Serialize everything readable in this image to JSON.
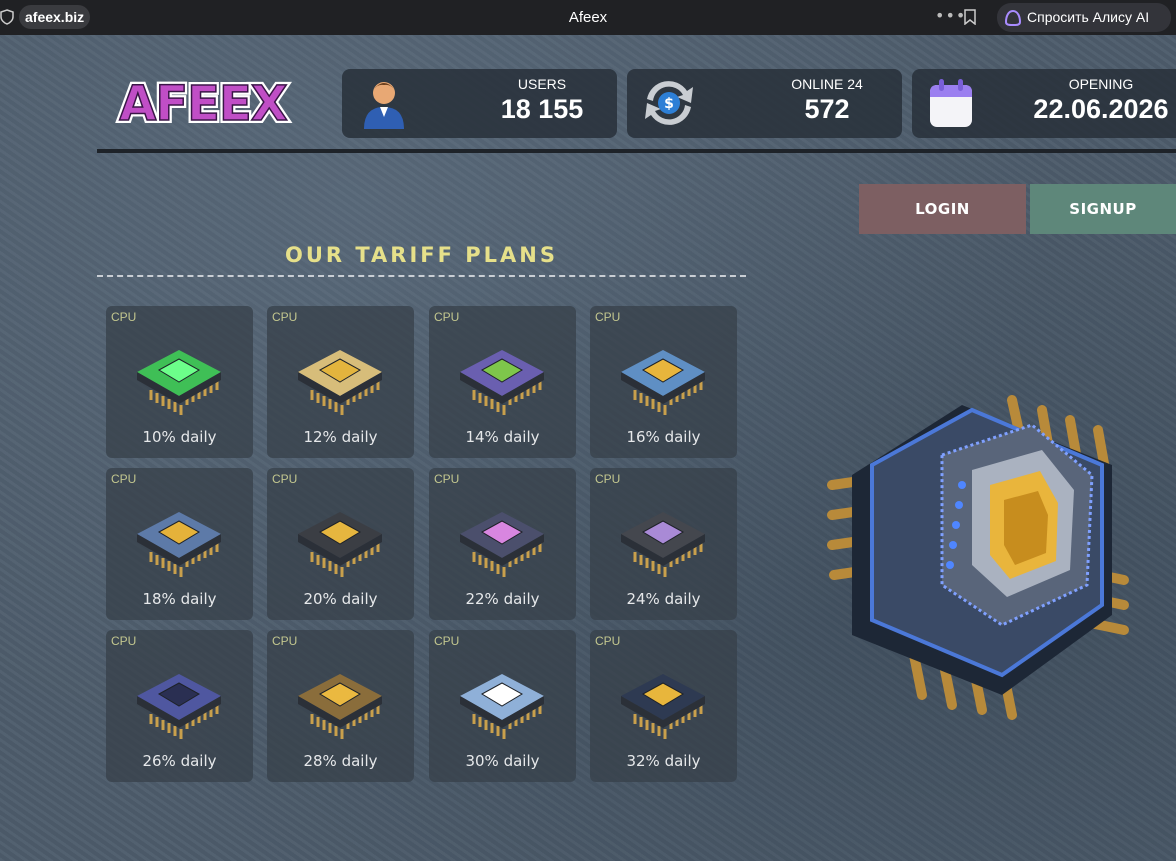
{
  "browser": {
    "url": "afeex.biz",
    "tab_title": "Afeex",
    "alice_button": "Спросить Алису AI"
  },
  "logo_text": "AFEEX",
  "stats": [
    {
      "label": "USERS",
      "value": "18 155",
      "icon": "user-icon"
    },
    {
      "label": "ONLINE 24",
      "value": "572",
      "icon": "exchange-icon"
    },
    {
      "label": "OPENING",
      "value": "22.06.2026",
      "icon": "calendar-icon"
    }
  ],
  "auth": {
    "login_label": "LOGIN",
    "signup_label": "SIGNUP"
  },
  "plans_section": {
    "title": "OUR TARIFF PLANS",
    "plans": [
      {
        "tag": "CPU",
        "rate": "10% daily",
        "chip_color": "#3fbf56",
        "die_color": "#6cff8a"
      },
      {
        "tag": "CPU",
        "rate": "12% daily",
        "chip_color": "#d7bd7a",
        "die_color": "#e3b43d"
      },
      {
        "tag": "CPU",
        "rate": "14% daily",
        "chip_color": "#6a5fb0",
        "die_color": "#7ec64b"
      },
      {
        "tag": "CPU",
        "rate": "16% daily",
        "chip_color": "#5f8fc4",
        "die_color": "#e8b53c"
      },
      {
        "tag": "CPU",
        "rate": "18% daily",
        "chip_color": "#5d7aa8",
        "die_color": "#e5b23a"
      },
      {
        "tag": "CPU",
        "rate": "20% daily",
        "chip_color": "#3b3e44",
        "die_color": "#e6b63f"
      },
      {
        "tag": "CPU",
        "rate": "22% daily",
        "chip_color": "#4b4f6c",
        "die_color": "#d886e0"
      },
      {
        "tag": "CPU",
        "rate": "24% daily",
        "chip_color": "#44474e",
        "die_color": "#a98ad6"
      },
      {
        "tag": "CPU",
        "rate": "26% daily",
        "chip_color": "#4f57a0",
        "die_color": "#2a2f52"
      },
      {
        "tag": "CPU",
        "rate": "28% daily",
        "chip_color": "#8a6d3b",
        "die_color": "#ebb940"
      },
      {
        "tag": "CPU",
        "rate": "30% daily",
        "chip_color": "#8fb0d8",
        "die_color": "#ffffff"
      },
      {
        "tag": "CPU",
        "rate": "32% daily",
        "chip_color": "#2e3a52",
        "die_color": "#e8b63c"
      }
    ]
  }
}
